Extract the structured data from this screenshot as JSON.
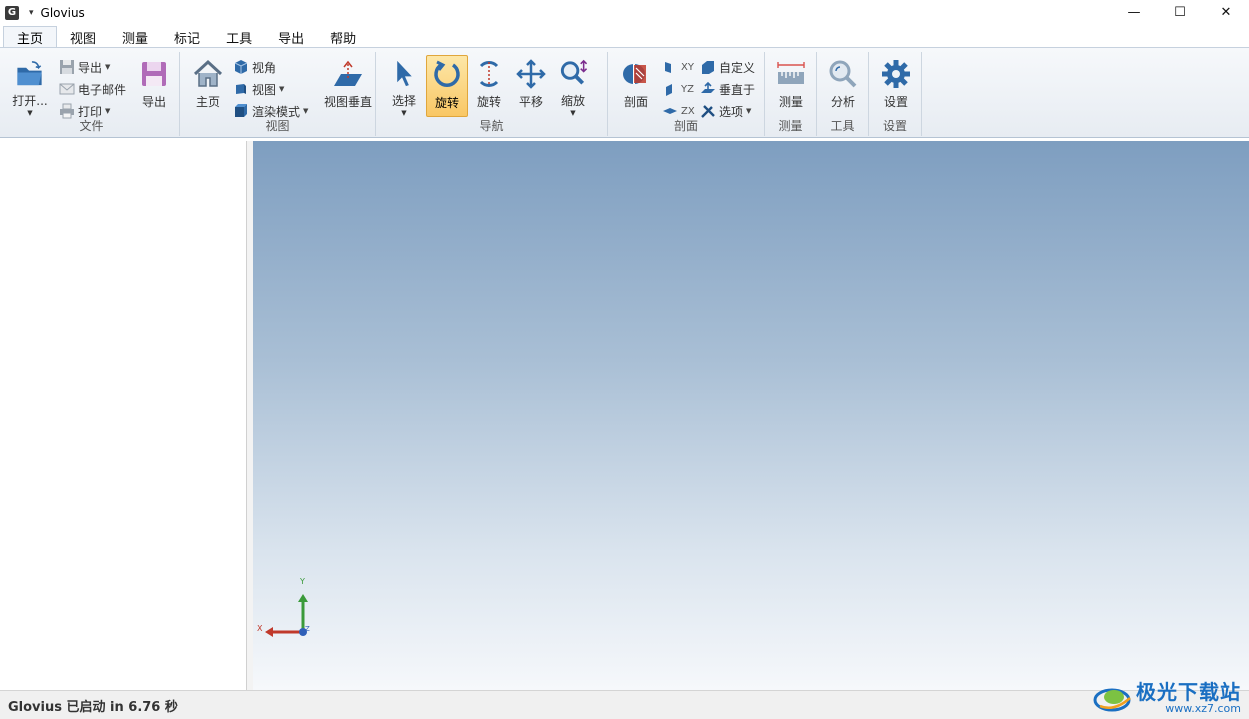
{
  "window": {
    "app_icon_letter": "G",
    "qat_glyph": "▾",
    "title": "Glovius",
    "min_glyph": "—",
    "max_glyph": "☐",
    "close_glyph": "✕"
  },
  "tabs": [
    {
      "label": "主页",
      "active": true
    },
    {
      "label": "视图"
    },
    {
      "label": "测量"
    },
    {
      "label": "标记"
    },
    {
      "label": "工具"
    },
    {
      "label": "导出"
    },
    {
      "label": "帮助"
    }
  ],
  "ribbon": {
    "file": {
      "label": "文件",
      "open": "打开...",
      "export_small": "导出",
      "email": "电子邮件",
      "print": "打印",
      "export_big": "导出"
    },
    "view": {
      "label": "视图",
      "home": "主页",
      "angle": "视角",
      "view": "视图",
      "render_mode": "渲染模式",
      "view_normal": "视图垂直"
    },
    "nav": {
      "label": "导航",
      "select": "选择",
      "rotate_active": "旋转",
      "rotate": "旋转",
      "pan": "平移",
      "zoom": "缩放"
    },
    "section": {
      "label": "剖面",
      "section_big": "剖面",
      "xy": "XY",
      "yz": "YZ",
      "zx": "ZX",
      "custom": "自定义",
      "perpendicular": "垂直于",
      "options": "选项"
    },
    "measure": {
      "label": "测量",
      "button": "测量"
    },
    "tools": {
      "label": "工具",
      "button": "分析"
    },
    "settings": {
      "label": "设置",
      "button": "设置"
    }
  },
  "triad": {
    "x": "X",
    "y": "Y",
    "z": "Z"
  },
  "status": {
    "text": "Glovius 已启动 in 6.76 秒"
  },
  "watermark": {
    "name": "极光下载站",
    "url": "www.xz7.com"
  },
  "colors": {
    "accent_active": "#f9c765",
    "ribbon_icon_blue": "#2f6aa8",
    "viewport_top": "#7e9ec0",
    "viewport_bottom": "#f6f8fb"
  }
}
